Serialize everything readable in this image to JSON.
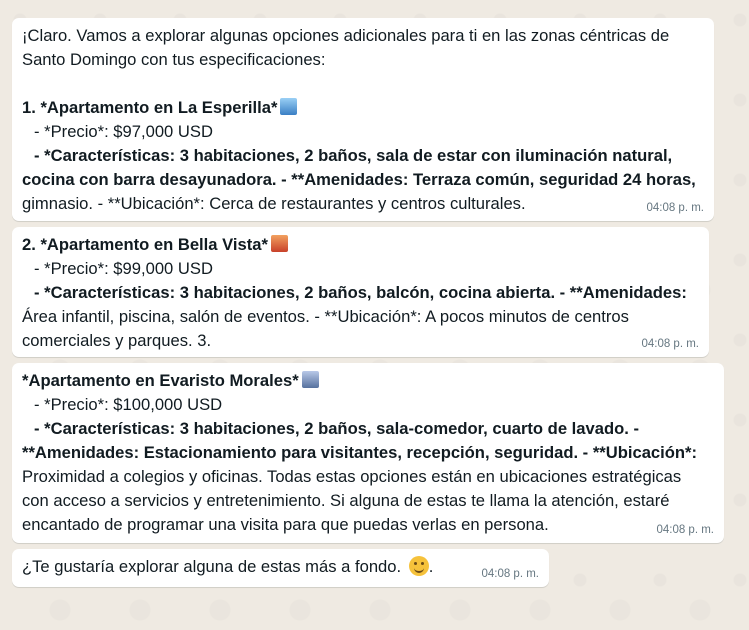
{
  "messages": [
    {
      "lines": [
        "¡Claro. Vamos a explorar algunas opciones adicionales para ti en las zonas céntricas de",
        "Santo Domingo con tus especificaciones:",
        "",
        "1. *Apartamento en La Esperilla*",
        "- *Precio*: $97,000 USD",
        "- *Características: 3 habitaciones, 2 baños, sala de estar con iluminación natural,",
        "cocina con barra desayunadora. - **Amenidades: Terraza común, seguridad 24 horas,",
        "gimnasio. - **Ubicación*: Cerca de restaurantes y centros culturales."
      ],
      "time": "04:08 p. m.",
      "icon": "building-icon"
    },
    {
      "lines": [
        "2. *Apartamento en Bella Vista*",
        "- *Precio*: $99,000 USD",
        "- *Características: 3 habitaciones, 2 baños, balcón, cocina abierta. - **Amenidades:",
        "Área infantil, piscina, salón de eventos. - **Ubicación*: A pocos minutos de centros",
        "comerciales y parques. 3."
      ],
      "time": "04:08 p. m.",
      "icon": "sunset-city-icon"
    },
    {
      "lines": [
        "*Apartamento en Evaristo Morales*",
        "- *Precio*: $100,000 USD",
        "- *Características: 3 habitaciones, 2 baños, sala-comedor, cuarto de lavado. -",
        "**Amenidades: Estacionamiento para visitantes, recepción, seguridad. - **Ubicación*:",
        "Proximidad a colegios y oficinas. Todas estas opciones están en ubicaciones estratégicas",
        "con acceso a servicios y entretenimiento. Si alguna de estas te llama la atención, estaré",
        "encantado de programar una visita para que puedas verlas en persona."
      ],
      "time": "04:08 p. m.",
      "icon": "cityscape-icon"
    },
    {
      "lines": [
        "¿Te gustaría explorar alguna de estas más a fondo."
      ],
      "time": "04:08 p. m.",
      "icon": "smiling-face-icon"
    }
  ]
}
